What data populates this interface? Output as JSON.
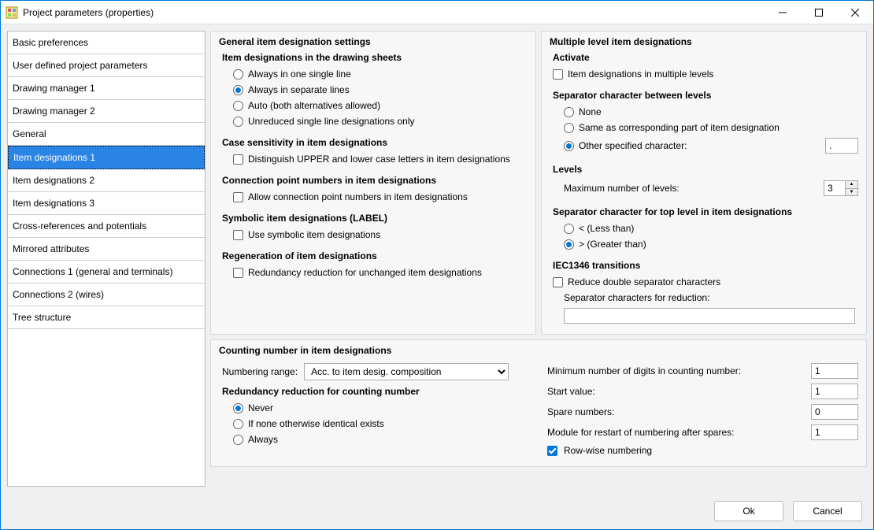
{
  "window": {
    "title": "Project parameters (properties)"
  },
  "sidebar": {
    "items": [
      {
        "label": "Basic preferences"
      },
      {
        "label": "User defined project parameters"
      },
      {
        "label": "Drawing manager 1"
      },
      {
        "label": "Drawing manager 2"
      },
      {
        "label": "General"
      },
      {
        "label": "Item designations 1",
        "selected": true
      },
      {
        "label": "Item designations 2"
      },
      {
        "label": "Item designations 3"
      },
      {
        "label": "Cross-references and potentials"
      },
      {
        "label": "Mirrored attributes"
      },
      {
        "label": "Connections 1 (general and terminals)"
      },
      {
        "label": "Connections 2 (wires)"
      },
      {
        "label": "Tree structure"
      }
    ]
  },
  "general": {
    "title": "General item designation settings",
    "drawing": {
      "title": "Item designations in the drawing sheets",
      "opts": [
        "Always in one single line",
        "Always in separate lines",
        "Auto (both alternatives allowed)",
        "Unreduced single line designations only"
      ],
      "selected": 1
    },
    "case": {
      "title": "Case sensitivity in item designations",
      "opt": "Distinguish UPPER and lower case letters in item designations",
      "checked": false
    },
    "conn": {
      "title": "Connection point numbers in item designations",
      "opt": "Allow connection point numbers in item designations",
      "checked": false
    },
    "symbolic": {
      "title": "Symbolic item designations (LABEL)",
      "opt": "Use symbolic item designations",
      "checked": false
    },
    "regen": {
      "title": "Regeneration of item designations",
      "opt": "Redundancy reduction for unchanged item designations",
      "checked": false
    }
  },
  "multi": {
    "title": "Multiple level item designations",
    "activate": {
      "title": "Activate",
      "opt": "Item designations in multiple levels",
      "checked": false
    },
    "sep": {
      "title": "Separator character between levels",
      "opts": [
        "None",
        "Same as corresponding part of item designation",
        "Other specified character:"
      ],
      "selected": 2,
      "other": "."
    },
    "levels": {
      "title": "Levels",
      "label": "Maximum number of levels:",
      "value": "3"
    },
    "topsep": {
      "title": "Separator character for top level in item designations",
      "opts": [
        "< (Less than)",
        "> (Greater than)"
      ],
      "selected": 1
    },
    "iec": {
      "title": "IEC1346 transitions",
      "reduce": "Reduce double separator characters",
      "reduce_checked": false,
      "sepred_label": "Separator characters for reduction:",
      "sepred_value": ""
    }
  },
  "counting": {
    "title": "Counting number in item designations",
    "range_label": "Numbering range:",
    "range_value": "Acc. to item desig. composition",
    "redund": {
      "title": "Redundancy reduction for counting number",
      "opts": [
        "Never",
        "If none otherwise identical exists",
        "Always"
      ],
      "selected": 0
    },
    "right": {
      "min_digits": {
        "label": "Minimum number of digits in counting number:",
        "value": "1"
      },
      "start": {
        "label": "Start value:",
        "value": "1"
      },
      "spare": {
        "label": "Spare numbers:",
        "value": "0"
      },
      "module": {
        "label": "Module for restart of numbering after spares:",
        "value": "1"
      },
      "rowwise": {
        "label": "Row-wise numbering",
        "checked": true
      }
    }
  },
  "footer": {
    "ok": "Ok",
    "cancel": "Cancel"
  }
}
